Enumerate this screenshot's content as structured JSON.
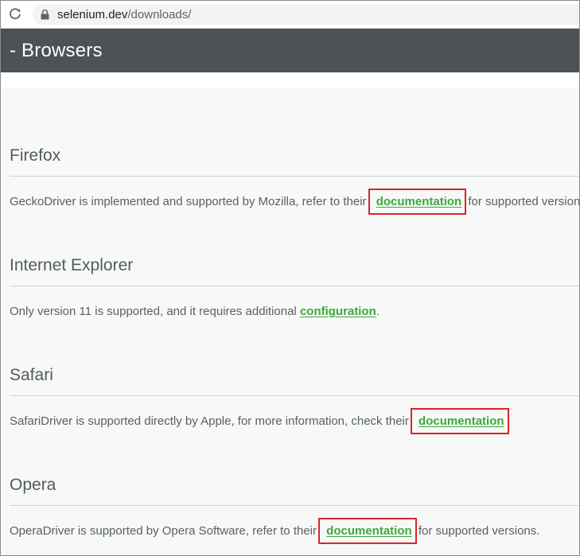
{
  "browser": {
    "url_host": "selenium.dev",
    "url_path": "/downloads/"
  },
  "banner": {
    "title": "- Browsers"
  },
  "sections": [
    {
      "heading": "Firefox",
      "text_before": "GeckoDriver is implemented and supported by Mozilla, refer to their ",
      "link": "documentation",
      "text_after": " for supported versions."
    },
    {
      "heading": "Internet Explorer",
      "text_before": "Only version 11 is supported, and it requires additional ",
      "link": "configuration",
      "text_after": "."
    },
    {
      "heading": "Safari",
      "text_before": "SafariDriver is supported directly by Apple, for more information, check their ",
      "link": "documentation",
      "text_after": ""
    },
    {
      "heading": "Opera",
      "text_before": "OperaDriver is supported by Opera Software, refer to their ",
      "link": "documentation",
      "text_after": " for supported versions."
    }
  ],
  "colors": {
    "link": "#3da839",
    "highlight_box": "#d7262b",
    "banner_bg": "#4c5256"
  }
}
